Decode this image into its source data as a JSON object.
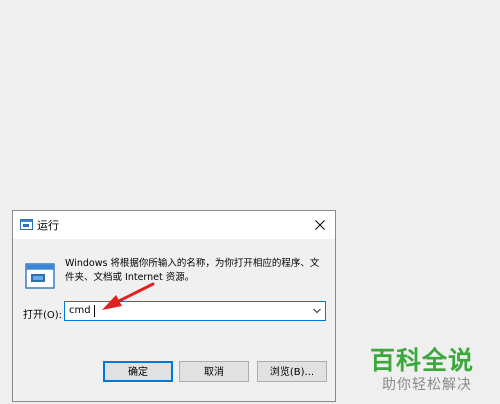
{
  "dialog": {
    "title": "运行",
    "description": "Windows 将根据你所输入的名称，为你打开相应的程序、文件夹、文档或 Internet 资源。",
    "open_label": "打开(O):",
    "open_value": "cmd",
    "buttons": {
      "ok": "确定",
      "cancel": "取消",
      "browse": "浏览(B)..."
    },
    "icons": {
      "title": "run-icon",
      "big": "run-icon",
      "close": "close-icon",
      "dropdown": "chevron-down-icon"
    }
  },
  "annotation": {
    "arrow_color": "#e02020"
  },
  "watermark": {
    "main": "百科全说",
    "sub": "助你轻松解决",
    "color": "#3aa83a"
  }
}
